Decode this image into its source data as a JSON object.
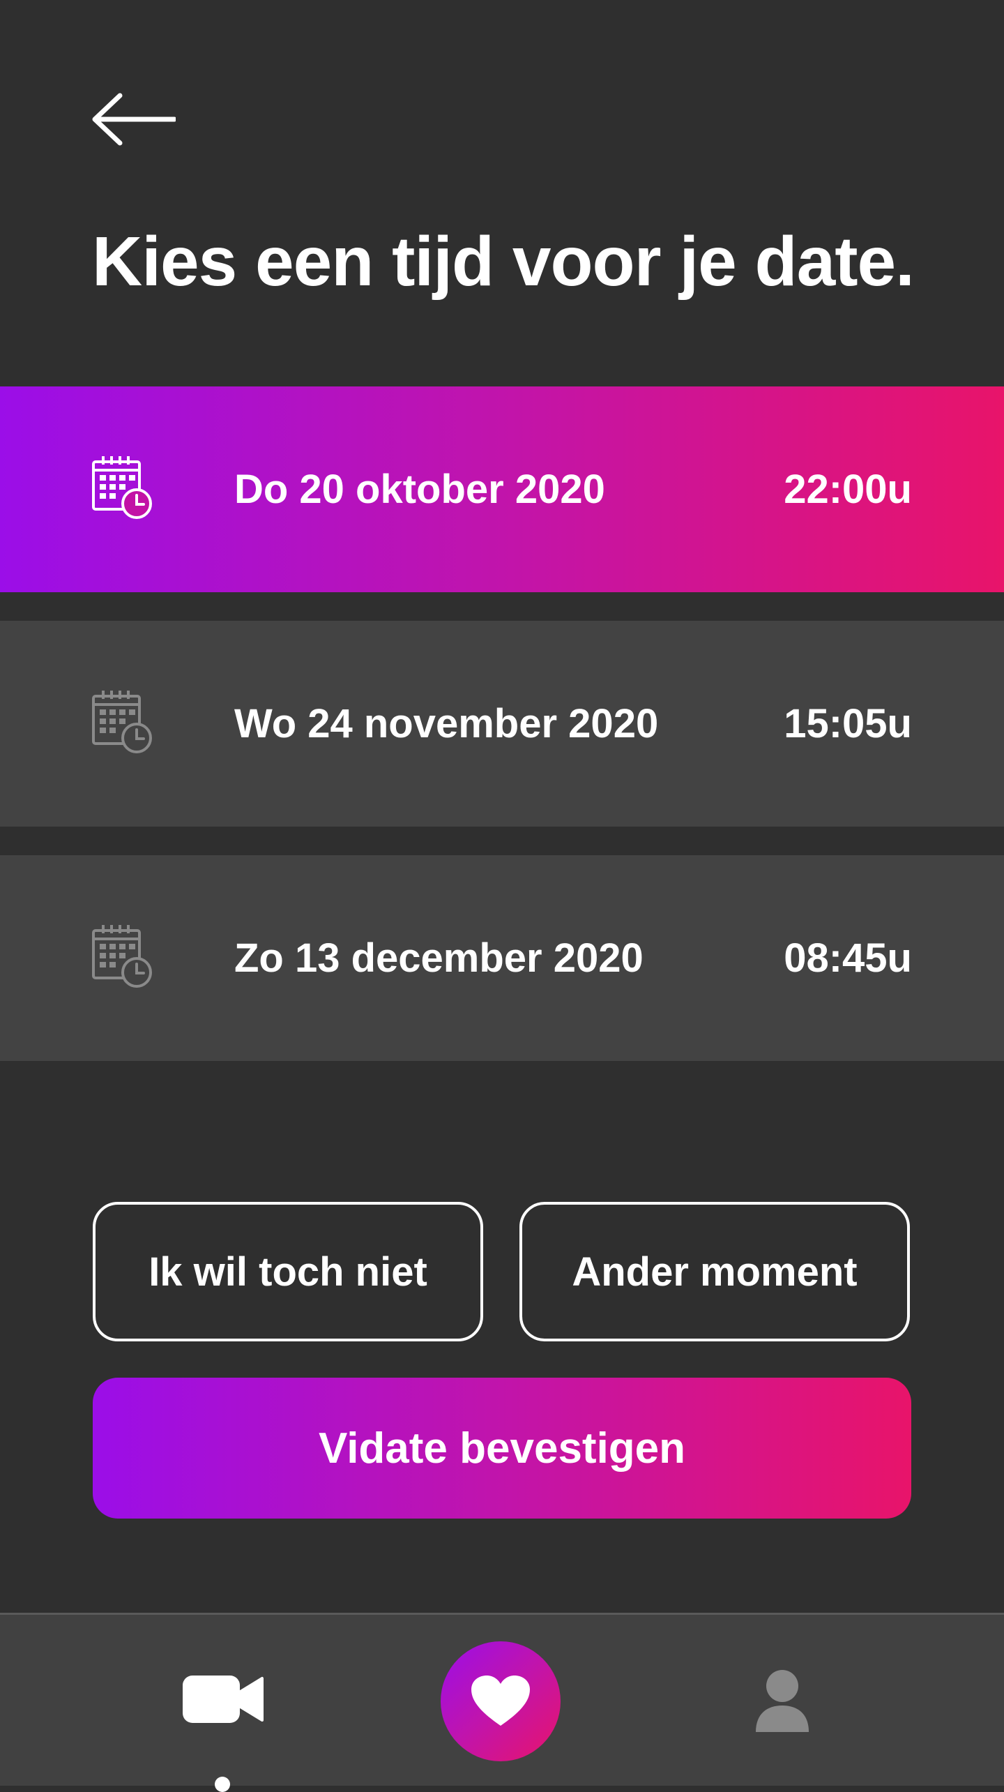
{
  "header": {
    "back_icon": "arrow-left-icon",
    "title": "Kies een tijd voor je date."
  },
  "slots": [
    {
      "date": "Do 20 oktober 2020",
      "time": "22:00u",
      "selected": true,
      "icon": "calendar-clock-icon"
    },
    {
      "date": "Wo 24 november 2020",
      "time": "15:05u",
      "selected": false,
      "icon": "calendar-clock-icon"
    },
    {
      "date": "Zo 13 december 2020",
      "time": "08:45u",
      "selected": false,
      "icon": "calendar-clock-icon"
    }
  ],
  "actions": {
    "decline_label": "Ik wil toch niet",
    "other_label": "Ander moment",
    "confirm_label": "Vidate bevestigen"
  },
  "nav": {
    "items": [
      {
        "icon": "video-camera-icon",
        "active": true
      },
      {
        "icon": "heart-icon",
        "active": false
      },
      {
        "icon": "user-icon",
        "active": false
      }
    ]
  },
  "colors": {
    "background": "#2f2f2f",
    "card": "#434343",
    "nav": "#414141",
    "gradient_start": "#9b0ee8",
    "gradient_end": "#e8146a",
    "text": "#ffffff",
    "icon_muted": "#8a8a8a"
  }
}
